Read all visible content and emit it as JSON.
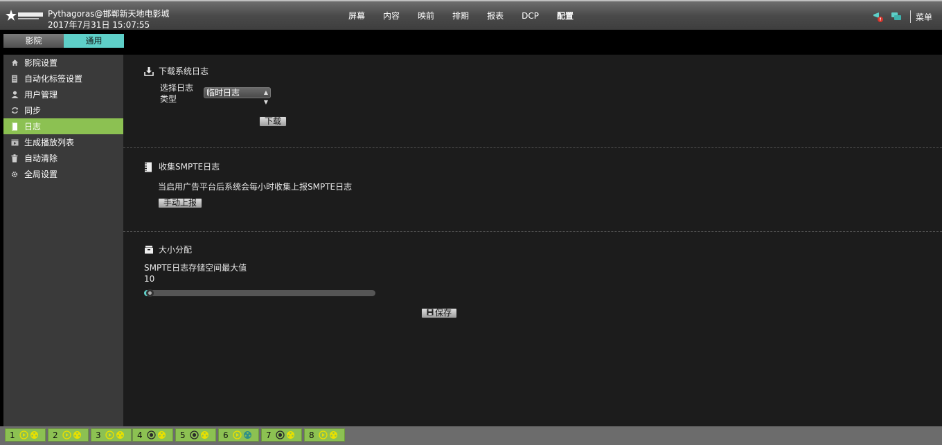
{
  "header": {
    "site": "Pythagoras@邯郸新天地电影城",
    "datetime": "2017年7月31日 15:07:55",
    "menu_label": "菜单"
  },
  "nav": [
    {
      "label": "屏幕"
    },
    {
      "label": "内容"
    },
    {
      "label": "映前"
    },
    {
      "label": "排期"
    },
    {
      "label": "报表"
    },
    {
      "label": "DCP"
    },
    {
      "label": "配置",
      "active": true
    }
  ],
  "tabs": [
    {
      "label": "影院",
      "active": false
    },
    {
      "label": "通用",
      "active": true
    }
  ],
  "sidebar": {
    "items": [
      {
        "label": "影院设置",
        "icon": "home-icon"
      },
      {
        "label": "自动化标签设置",
        "icon": "document-icon"
      },
      {
        "label": "用户管理",
        "icon": "user-icon"
      },
      {
        "label": "同步",
        "icon": "sync-icon"
      },
      {
        "label": "日志",
        "icon": "log-icon",
        "active": true
      },
      {
        "label": "生成播放列表",
        "icon": "playlist-icon"
      },
      {
        "label": "自动清除",
        "icon": "trash-icon"
      },
      {
        "label": "全局设置",
        "icon": "gear-icon"
      }
    ]
  },
  "download": {
    "title": "下载系统日志",
    "select_label_line1": "选择日志",
    "select_label_line2": "类型",
    "select_value": "临时日志",
    "button": "下载"
  },
  "smpte": {
    "title": "收集SMPTE日志",
    "description": "当启用广告平台后系统会每小时收集上报SMPTE日志",
    "button": "手动上报"
  },
  "allocation": {
    "title": "大小分配",
    "label": "SMPTE日志存储空间最大值",
    "value": "10",
    "slider_fraction": 0.02,
    "save_button": "保存"
  },
  "screens": [
    {
      "number": "1"
    },
    {
      "number": "2"
    },
    {
      "number": "3"
    },
    {
      "number": "4"
    },
    {
      "number": "5"
    },
    {
      "number": "6"
    },
    {
      "number": "7"
    },
    {
      "number": "8"
    }
  ],
  "colors": {
    "accent_green": "#8cc152",
    "accent_teal": "#5ecfc8",
    "status_yellow": "#e8e000"
  }
}
